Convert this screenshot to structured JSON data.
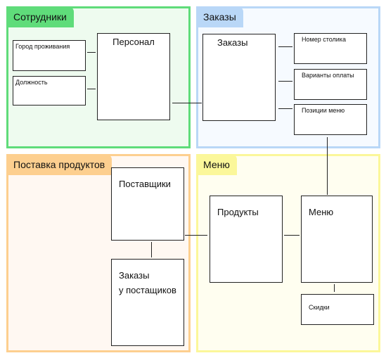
{
  "regions": {
    "staff": {
      "title": "Сотрудники",
      "border": "#5fdc7a",
      "fill": "#eefbef",
      "tab": "#5fdc7a"
    },
    "orders": {
      "title": "Заказы",
      "border": "#b9d7f7",
      "fill": "#f6faff",
      "tab": "#b9d7f7"
    },
    "supply": {
      "title": "Поставка продуктов",
      "border": "#fdcf8f",
      "fill": "#fff8f2",
      "tab": "#fdcf8f"
    },
    "menu": {
      "title": "Меню",
      "border": "#fbf79a",
      "fill": "#fffef0",
      "tab": "#fbf79a"
    }
  },
  "boxes": {
    "city": "Город проживания",
    "position": "Должность",
    "personnel": "Персонал",
    "orders": "Заказы",
    "table_number": "Номер столика",
    "payment_options": "Варианты оплаты",
    "menu_items": "Позиции меню",
    "suppliers": "Поставщики",
    "supplier_orders_1": "Заказы",
    "supplier_orders_2": "у постащиков",
    "products": "Продукты",
    "menu": "Меню",
    "discounts": "Скидки"
  }
}
